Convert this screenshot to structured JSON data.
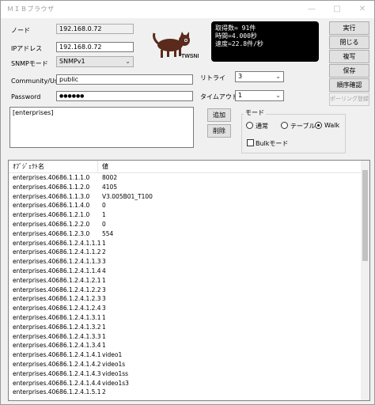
{
  "window": {
    "title": "ＭＩＢブラウザ"
  },
  "form": {
    "node_label": "ノード",
    "node_value": "192.168.0.72",
    "ip_label": "IPアドレス",
    "ip_value": "192.168.0.72",
    "snmp_mode_label": "SNMPモード",
    "snmp_mode_value": "SNMPv1",
    "community_label": "Community/User",
    "community_value": "public",
    "password_label": "Password",
    "password_value": "●●●●●●",
    "retry_label": "リトライ",
    "retry_value": "3",
    "timeout_label": "タイムアウト",
    "timeout_value": "1"
  },
  "stats": {
    "line1": "取得数=   91件",
    "line2": "時間=4.000秒",
    "line3": "速度=22.8件/秒"
  },
  "buttons": {
    "run": "実行",
    "close": "閉じる",
    "copy": "複写",
    "save": "保存",
    "order_check": "順序確認",
    "polling_register": "ポーリング登録",
    "add": "追加",
    "delete": "削除"
  },
  "oid_list": [
    "[enterprises]"
  ],
  "mode": {
    "group_label": "モード",
    "normal": "通常",
    "table": "テーブル",
    "walk": "Walk",
    "selected": "walk",
    "bulk_label": "Bulkモード",
    "bulk_checked": false
  },
  "table": {
    "columns": [
      "ｵﾌﾞｼﾞｪｸﾄ名",
      "値"
    ],
    "rows": [
      [
        "enterprises.40686.1.1.1.0",
        "8002"
      ],
      [
        "enterprises.40686.1.1.2.0",
        "4105"
      ],
      [
        "enterprises.40686.1.1.3.0",
        "V3.005B01_T100"
      ],
      [
        "enterprises.40686.1.1.4.0",
        "0"
      ],
      [
        "enterprises.40686.1.2.1.0",
        "1"
      ],
      [
        "enterprises.40686.1.2.2.0",
        "0"
      ],
      [
        "enterprises.40686.1.2.3.0",
        "554"
      ],
      [
        "enterprises.40686.1.2.4.1.1.1",
        "1"
      ],
      [
        "enterprises.40686.1.2.4.1.1.2",
        "2"
      ],
      [
        "enterprises.40686.1.2.4.1.1.3",
        "3"
      ],
      [
        "enterprises.40686.1.2.4.1.1.4",
        "4"
      ],
      [
        "enterprises.40686.1.2.4.1.2.1",
        "1"
      ],
      [
        "enterprises.40686.1.2.4.1.2.2",
        "3"
      ],
      [
        "enterprises.40686.1.2.4.1.2.3",
        "3"
      ],
      [
        "enterprises.40686.1.2.4.1.2.4",
        "3"
      ],
      [
        "enterprises.40686.1.2.4.1.3.1",
        "1"
      ],
      [
        "enterprises.40686.1.2.4.1.3.2",
        "1"
      ],
      [
        "enterprises.40686.1.2.4.1.3.3",
        "1"
      ],
      [
        "enterprises.40686.1.2.4.1.3.4",
        "1"
      ],
      [
        "enterprises.40686.1.2.4.1.4.1",
        "video1"
      ],
      [
        "enterprises.40686.1.2.4.1.4.2",
        "video1s"
      ],
      [
        "enterprises.40686.1.2.4.1.4.3",
        "video1ss"
      ],
      [
        "enterprises.40686.1.2.4.1.4.4",
        "video1s3"
      ],
      [
        "enterprises.40686.1.2.4.1.5.1",
        "2"
      ]
    ]
  }
}
